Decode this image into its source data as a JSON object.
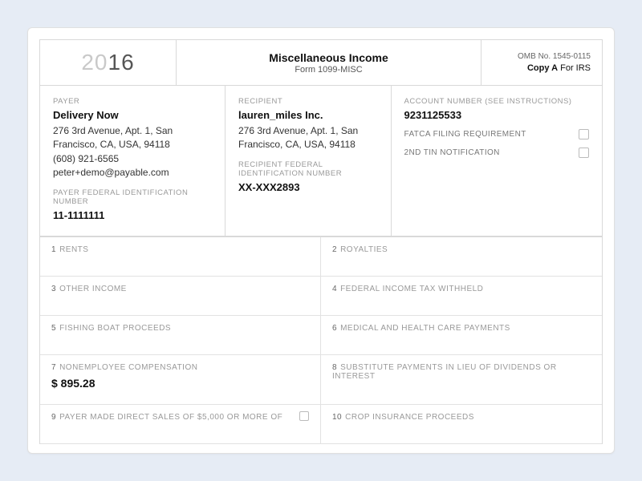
{
  "year_prefix": "20",
  "year_suffix": "16",
  "title": "Miscellaneous Income",
  "subtitle": "Form 1099-MISC",
  "omb": "OMB No. 1545-0115",
  "copy_label_strong": "Copy A",
  "copy_label_rest": " For IRS",
  "payer": {
    "label": "PAYER",
    "name": "Delivery Now",
    "address": "276 3rd Avenue, Apt. 1, San Francisco, CA, USA, 94118",
    "phone": "(608) 921-6565",
    "email": "peter+demo@payable.com",
    "fed_id_label": "PAYER FEDERAL IDENTIFICATION NUMBER",
    "fed_id": "11-1111111"
  },
  "recipient": {
    "label": "RECIPIENT",
    "name": "lauren_miles Inc.",
    "address": "276 3rd Avenue, Apt. 1, San Francisco, CA, USA, 94118",
    "fed_id_label": "RECIPIENT FEDERAL IDENTIFICATION NUMBER",
    "fed_id": "XX-XXX2893"
  },
  "account": {
    "label": "ACCOUNT NUMBER (SEE INSTRUCTIONS)",
    "number": "9231125533",
    "fatca_label": "FATCA FILING REQUIREMENT",
    "tin_label": "2ND TIN NOTIFICATION"
  },
  "boxes": [
    {
      "num": "1",
      "label": "RENTS",
      "value": ""
    },
    {
      "num": "2",
      "label": "ROYALTIES",
      "value": ""
    },
    {
      "num": "3",
      "label": "OTHER INCOME",
      "value": ""
    },
    {
      "num": "4",
      "label": "FEDERAL INCOME TAX WITHHELD",
      "value": ""
    },
    {
      "num": "5",
      "label": "FISHING BOAT PROCEEDS",
      "value": ""
    },
    {
      "num": "6",
      "label": "MEDICAL AND HEALTH CARE PAYMENTS",
      "value": ""
    },
    {
      "num": "7",
      "label": "NONEMPLOYEE COMPENSATION",
      "value": "$ 895.28"
    },
    {
      "num": "8",
      "label": "SUBSTITUTE PAYMENTS IN LIEU OF DIVIDENDS OR INTEREST",
      "value": ""
    },
    {
      "num": "9",
      "label": "PAYER MADE DIRECT SALES OF $5,000 OR MORE OF",
      "value": "",
      "has_checkbox": true
    },
    {
      "num": "10",
      "label": "CROP INSURANCE PROCEEDS",
      "value": ""
    }
  ]
}
